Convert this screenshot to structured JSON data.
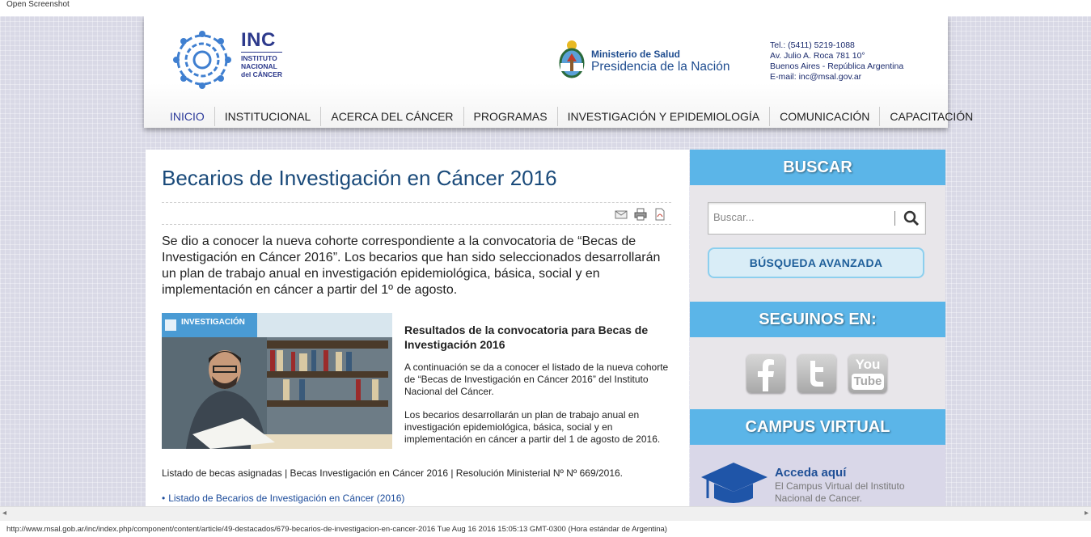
{
  "topbar": {
    "label": "Open Screenshot"
  },
  "header": {
    "inc_abbr": "INC",
    "inc_line1": "INSTITUTO",
    "inc_line2": "NACIONAL",
    "inc_line3": "del CÁNCER",
    "ministerio_small": "Ministerio de Salud",
    "ministerio_big": "Presidencia de la Nación",
    "contact": {
      "tel": "Tel.: (5411) 5219-1088",
      "address": "Av. Julio A. Roca 781 10°",
      "city": "Buenos Aires - República Argentina",
      "email_label": "E-mail:",
      "email": "inc@msal.gov.ar"
    }
  },
  "nav": [
    {
      "label": "INICIO"
    },
    {
      "label": "INSTITUCIONAL"
    },
    {
      "label": "ACERCA DEL CÁNCER"
    },
    {
      "label": "PROGRAMAS"
    },
    {
      "label": "INVESTIGACIÓN Y EPIDEMIOLOGÍA"
    },
    {
      "label": "COMUNICACIÓN"
    },
    {
      "label": "CAPACITACIÓN"
    }
  ],
  "article": {
    "title": "Becarios de Investigación en Cáncer 2016",
    "lead": "Se dio a conocer la nueva cohorte correspondiente a la convocatoria de “Becas de Investigación en Cáncer 2016”. Los becarios que han sido seleccionados desarrollarán un plan de trabajo anual en investigación epidemiológica, básica, social y en implementación en cáncer a partir del 1º de agosto.",
    "image_badge": "INVESTIGACIÓN",
    "subtitle": "Resultados de la convocatoria para Becas de Investigación 2016",
    "paragraph1": "A continuación se da a conocer el listado de la nueva cohorte de “Becas de Investigación en Cáncer 2016” del Instituto Nacional del Cáncer.",
    "paragraph2": "Los becarios desarrollarán un plan de trabajo anual en investigación epidemiológica, básica, social y en implementación en cáncer a partir del 1 de agosto de 2016.",
    "listado": "Listado de becas asignadas | Becas Investigación en Cáncer 2016 | Resolución Ministerial Nº Nº 669/2016.",
    "link": "Listado de Becarios de Investigación en Cáncer (2016)"
  },
  "sidebar": {
    "buscar_title": "BUSCAR",
    "search_placeholder": "Buscar...",
    "advanced_label": "BÚSQUEDA AVANZADA",
    "seguinos_title": "SEGUINOS EN:",
    "social": {
      "youtube_top": "You",
      "youtube_bottom": "Tube"
    },
    "campus_title": "CAMPUS VIRTUAL",
    "campus_link": "Acceda aquí",
    "campus_desc": "El Campus Virtual del Instituto Nacional de Cancer."
  },
  "status": {
    "url": "http://www.msal.gob.ar/inc/index.php/component/content/article/49-destacados/679-becarios-de-investigacion-en-cancer-2016 Tue Aug 16 2016 15:05:13 GMT-0300 (Hora estándar de Argentina)"
  },
  "scroll": {
    "left": "◂",
    "right": "▸"
  },
  "colors": {
    "accent": "#5bb5e8",
    "title_blue": "#1a4a7a",
    "nav_active": "#2c3a9a"
  }
}
